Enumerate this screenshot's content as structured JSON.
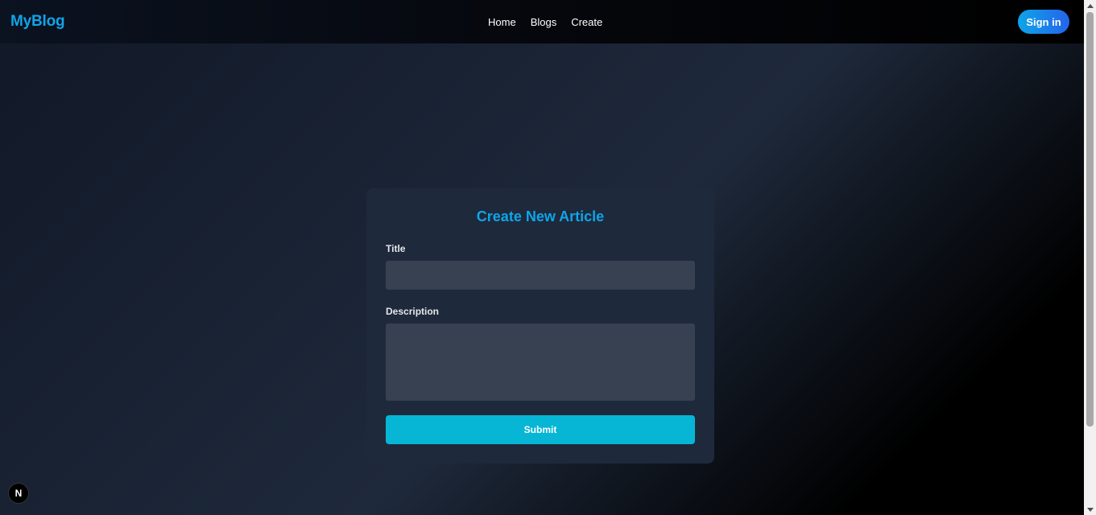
{
  "navbar": {
    "logo": "MyBlog",
    "links": [
      "Home",
      "Blogs",
      "Create"
    ],
    "signin_label": "Sign in"
  },
  "form": {
    "heading": "Create New Article",
    "title_label": "Title",
    "title_value": "",
    "description_label": "Description",
    "description_value": "",
    "submit_label": "Submit"
  },
  "badge": {
    "letter": "N"
  },
  "colors": {
    "accent": "#0ea5e9",
    "submit": "#06b6d4",
    "card": "#1e293b",
    "input": "#374151"
  },
  "icons": [
    "nextjs-logo-icon",
    "scroll-up-arrow-icon",
    "scroll-down-arrow-icon"
  ]
}
